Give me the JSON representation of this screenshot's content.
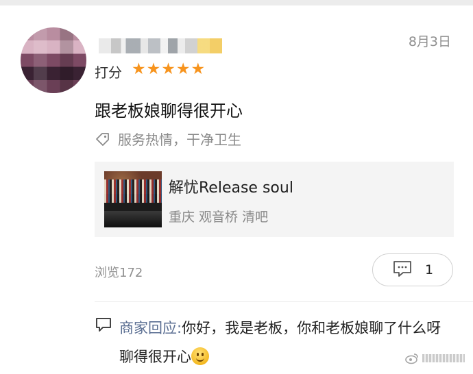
{
  "review": {
    "date": "8月3日",
    "rating_label": "打分",
    "stars": 5,
    "text": "跟老板娘聊得很开心",
    "tags": "服务热情，干净卫生",
    "views": "浏览172",
    "comments_count": "1"
  },
  "shop": {
    "name": "解忧Release soul",
    "meta": "重庆 观音桥 清吧"
  },
  "merchant_reply": {
    "label": "商家回应:",
    "text": "你好，我是老板，你和老板娘聊了什么呀聊得很开心"
  },
  "colors": {
    "star": "#f7941e",
    "reply_label": "#5a6e92",
    "muted_text": "#8a8a8a"
  },
  "icons": {
    "tag": "tag-icon",
    "comment": "comment-icon",
    "reply": "speech-bubble-icon",
    "emoji": "smiley-emoji"
  }
}
